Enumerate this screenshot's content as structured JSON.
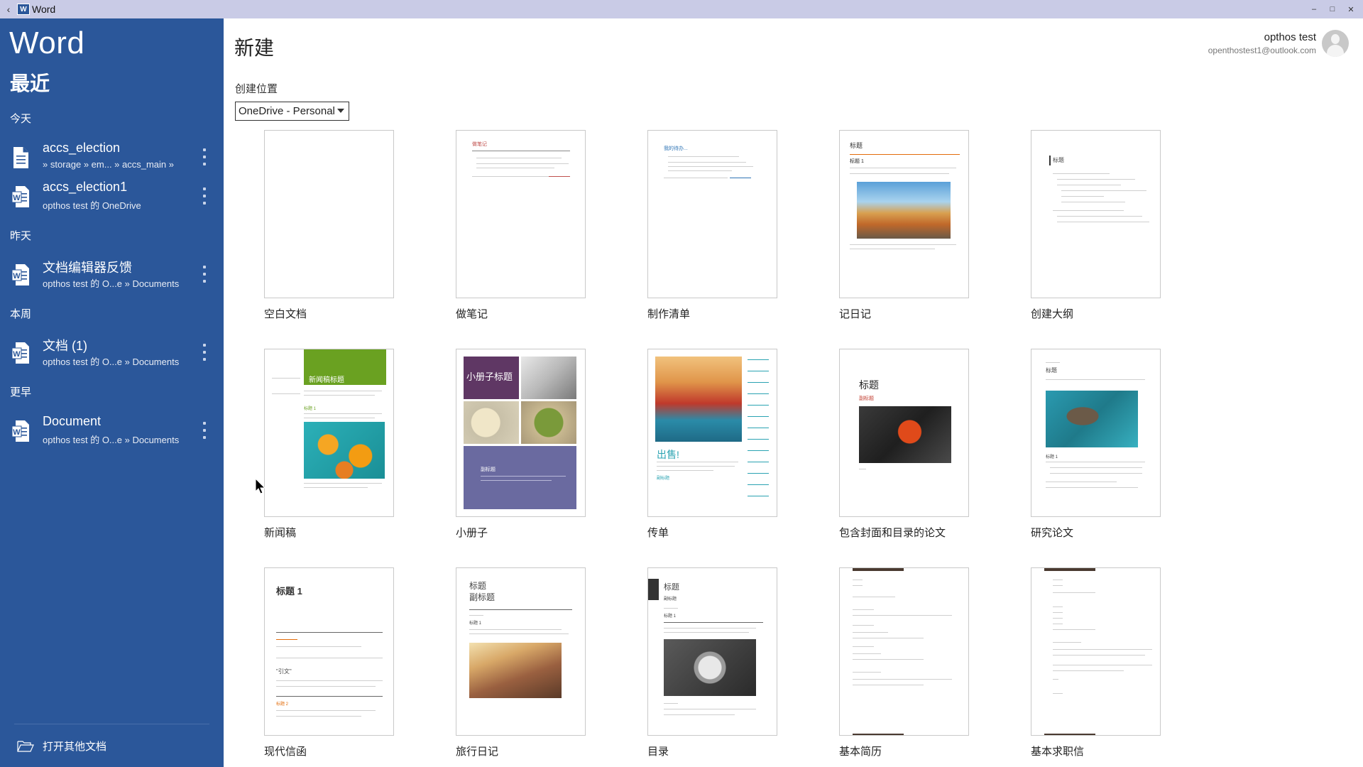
{
  "titlebar": {
    "title": "Word",
    "app_icon": "W"
  },
  "sidebar": {
    "app_name": "Word",
    "recent_title": "最近",
    "groups": [
      {
        "label": "今天",
        "items": [
          {
            "name": "accs_election",
            "path": "» storage » em... » accs_main »",
            "icon": "plain-file-icon"
          },
          {
            "name": "accs_election1",
            "path": "opthos test 的 OneDrive",
            "icon": "word-file-icon"
          }
        ]
      },
      {
        "label": "昨天",
        "items": [
          {
            "name": "文档编辑器反馈",
            "path": "opthos test 的 O...e » Documents",
            "icon": "word-file-icon"
          }
        ]
      },
      {
        "label": "本周",
        "items": [
          {
            "name": "文档 (1)",
            "path": "opthos test 的 O...e » Documents",
            "icon": "word-file-icon"
          }
        ]
      },
      {
        "label": "更早",
        "items": [
          {
            "name": "Document",
            "path": "opthos test 的 O...e » Documents",
            "icon": "word-file-icon"
          }
        ]
      }
    ],
    "open_other": "打开其他文档"
  },
  "main": {
    "title": "新建",
    "location_label": "创建位置",
    "location_value": "OneDrive - Personal",
    "user": {
      "name": "opthos test",
      "email": "openthostest1@outlook.com"
    },
    "templates": [
      {
        "label": "空白文档"
      },
      {
        "label": "做笔记"
      },
      {
        "label": "制作清单"
      },
      {
        "label": "记日记"
      },
      {
        "label": "创建大纲"
      },
      {
        "label": "新闻稿"
      },
      {
        "label": "小册子"
      },
      {
        "label": "传单"
      },
      {
        "label": "包含封面和目录的论文"
      },
      {
        "label": "研究论文"
      },
      {
        "label": "现代信函"
      },
      {
        "label": "旅行日记"
      },
      {
        "label": "目录"
      },
      {
        "label": "基本简历"
      },
      {
        "label": "基本求职信"
      }
    ],
    "thumb_text": {
      "note_title": "做笔记",
      "list_title": "我的待办...",
      "diary_title": "标题",
      "diary_heading": "标题 1",
      "outline_title": "标题",
      "news_title": "新闻稿标题",
      "news_heading": "标题 1",
      "brochure_title": "小册子标题",
      "brochure_sub": "副标题",
      "flyer_title": "出售!",
      "flyer_sub": "副标题",
      "paper_title": "标题",
      "paper_sub": "副标题",
      "research_title": "标题",
      "research_heading": "标题 1",
      "letter_heading": "标题 1",
      "letter_quote": "\"引文\"",
      "letter_h2": "标题 2",
      "travel_title": "标题",
      "travel_sub": "副标题",
      "travel_heading": "标题 1",
      "catalog_title": "标题",
      "catalog_sub": "副标题",
      "catalog_heading": "标题 1"
    }
  },
  "colors": {
    "sidebar_bg": "#2b579a",
    "titlebar_bg": "#c9cbe6",
    "accent_orange": "#e36c0a",
    "accent_green": "#6aa121",
    "accent_purple": "#5f3764",
    "accent_teal": "#2aa3b2"
  }
}
